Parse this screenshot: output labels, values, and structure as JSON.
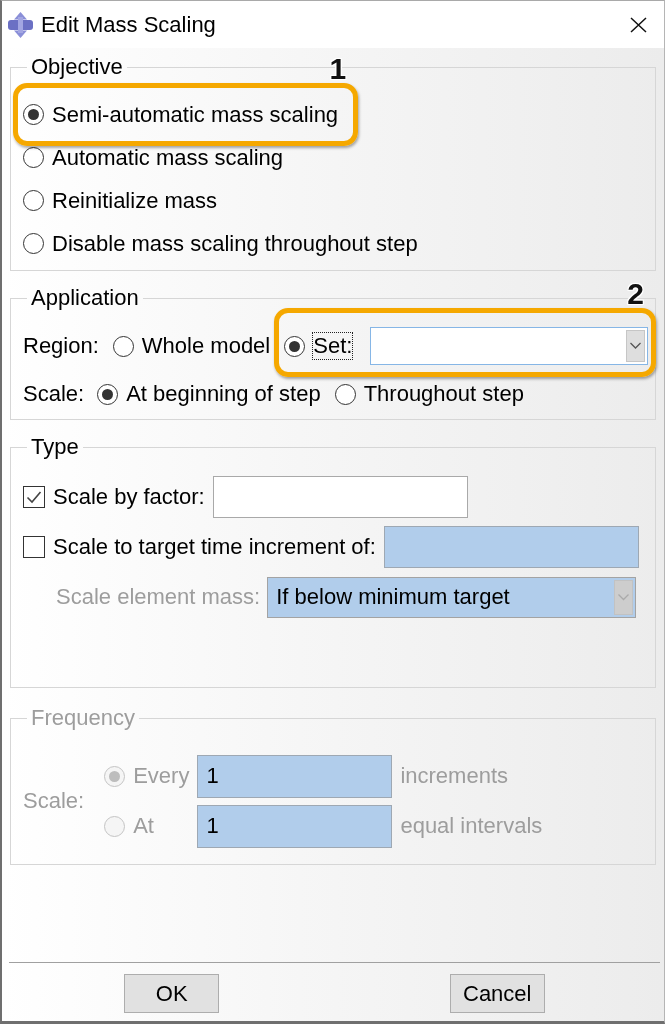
{
  "window": {
    "title": "Edit Mass Scaling"
  },
  "objective": {
    "legend": "Objective",
    "options": [
      {
        "label": "Semi-automatic mass scaling",
        "selected": true,
        "callout": "1"
      },
      {
        "label": "Automatic mass scaling",
        "selected": false
      },
      {
        "label": "Reinitialize mass",
        "selected": false
      },
      {
        "label": "Disable mass scaling throughout step",
        "selected": false
      }
    ]
  },
  "application": {
    "legend": "Application",
    "region": {
      "label": "Region:",
      "options": [
        {
          "label": "Whole model",
          "selected": false,
          "focused": false
        },
        {
          "label": "Set:",
          "selected": true,
          "focused": true
        }
      ],
      "set_dropdown": {
        "disabled": false
      },
      "callout": "2"
    },
    "scale": {
      "label": "Scale:",
      "options": [
        {
          "label": "At beginning of step",
          "selected": true
        },
        {
          "label": "Throughout step",
          "selected": false
        }
      ]
    }
  },
  "type": {
    "legend": "Type",
    "rows": [
      {
        "kind": "checkbox",
        "label": "Scale by factor:",
        "checked": true,
        "field": {
          "disabled": false
        }
      },
      {
        "kind": "checkbox",
        "label": "Scale to target time increment of:",
        "checked": false,
        "field": {
          "disabled": true
        }
      },
      {
        "kind": "dropdown",
        "label": "Scale element mass:",
        "value": "If below minimum target",
        "disabled": true
      }
    ]
  },
  "frequency": {
    "legend": "Frequency",
    "disabled": true,
    "label": "Scale:",
    "options": [
      {
        "label": "Every",
        "selected": true,
        "value": "1",
        "unit": "increments"
      },
      {
        "label": "At",
        "selected": false,
        "value": "1",
        "unit": "equal intervals"
      }
    ]
  },
  "buttons": [
    "OK",
    "Cancel"
  ]
}
